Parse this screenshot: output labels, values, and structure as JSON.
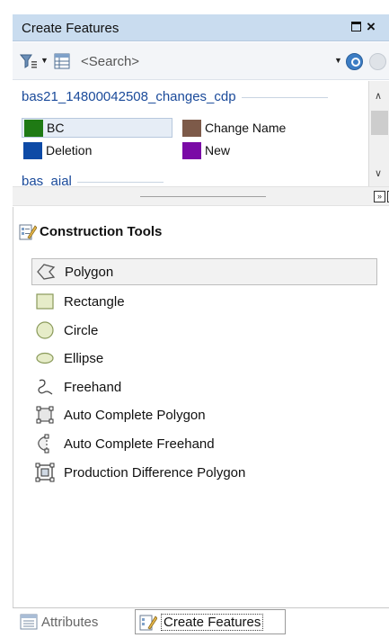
{
  "window": {
    "title": "Create Features"
  },
  "toolbar": {
    "search_placeholder": "<Search>"
  },
  "templates": {
    "groups": [
      {
        "name": "bas21_14800042508_changes_cdp",
        "items": [
          {
            "label": "BC",
            "color": "#1f7a14",
            "selected": true
          },
          {
            "label": "Change Name",
            "color": "#7d5a49",
            "selected": false
          },
          {
            "label": "Deletion",
            "color": "#0d4aa6",
            "selected": false
          },
          {
            "label": "New",
            "color": "#7a0aa6",
            "selected": false
          }
        ]
      },
      {
        "name": "bas_aial",
        "items": []
      }
    ]
  },
  "construction_tools": {
    "title": "Construction Tools",
    "items": [
      {
        "label": "Polygon",
        "icon": "polygon-icon",
        "selected": true
      },
      {
        "label": "Rectangle",
        "icon": "rectangle-icon",
        "selected": false
      },
      {
        "label": "Circle",
        "icon": "circle-icon",
        "selected": false
      },
      {
        "label": "Ellipse",
        "icon": "ellipse-icon",
        "selected": false
      },
      {
        "label": "Freehand",
        "icon": "freehand-icon",
        "selected": false
      },
      {
        "label": "Auto Complete Polygon",
        "icon": "auto-complete-polygon-icon",
        "selected": false
      },
      {
        "label": "Auto Complete Freehand",
        "icon": "auto-complete-freehand-icon",
        "selected": false
      },
      {
        "label": "Production Difference Polygon",
        "icon": "production-difference-polygon-icon",
        "selected": false
      }
    ]
  },
  "tabs": [
    {
      "label": "Attributes",
      "active": false
    },
    {
      "label": "Create Features",
      "active": true
    }
  ],
  "colors": {
    "titlebar": "#c9dcef",
    "group_header_text": "#1a4a9a",
    "search_button": "#3c7dc4"
  }
}
